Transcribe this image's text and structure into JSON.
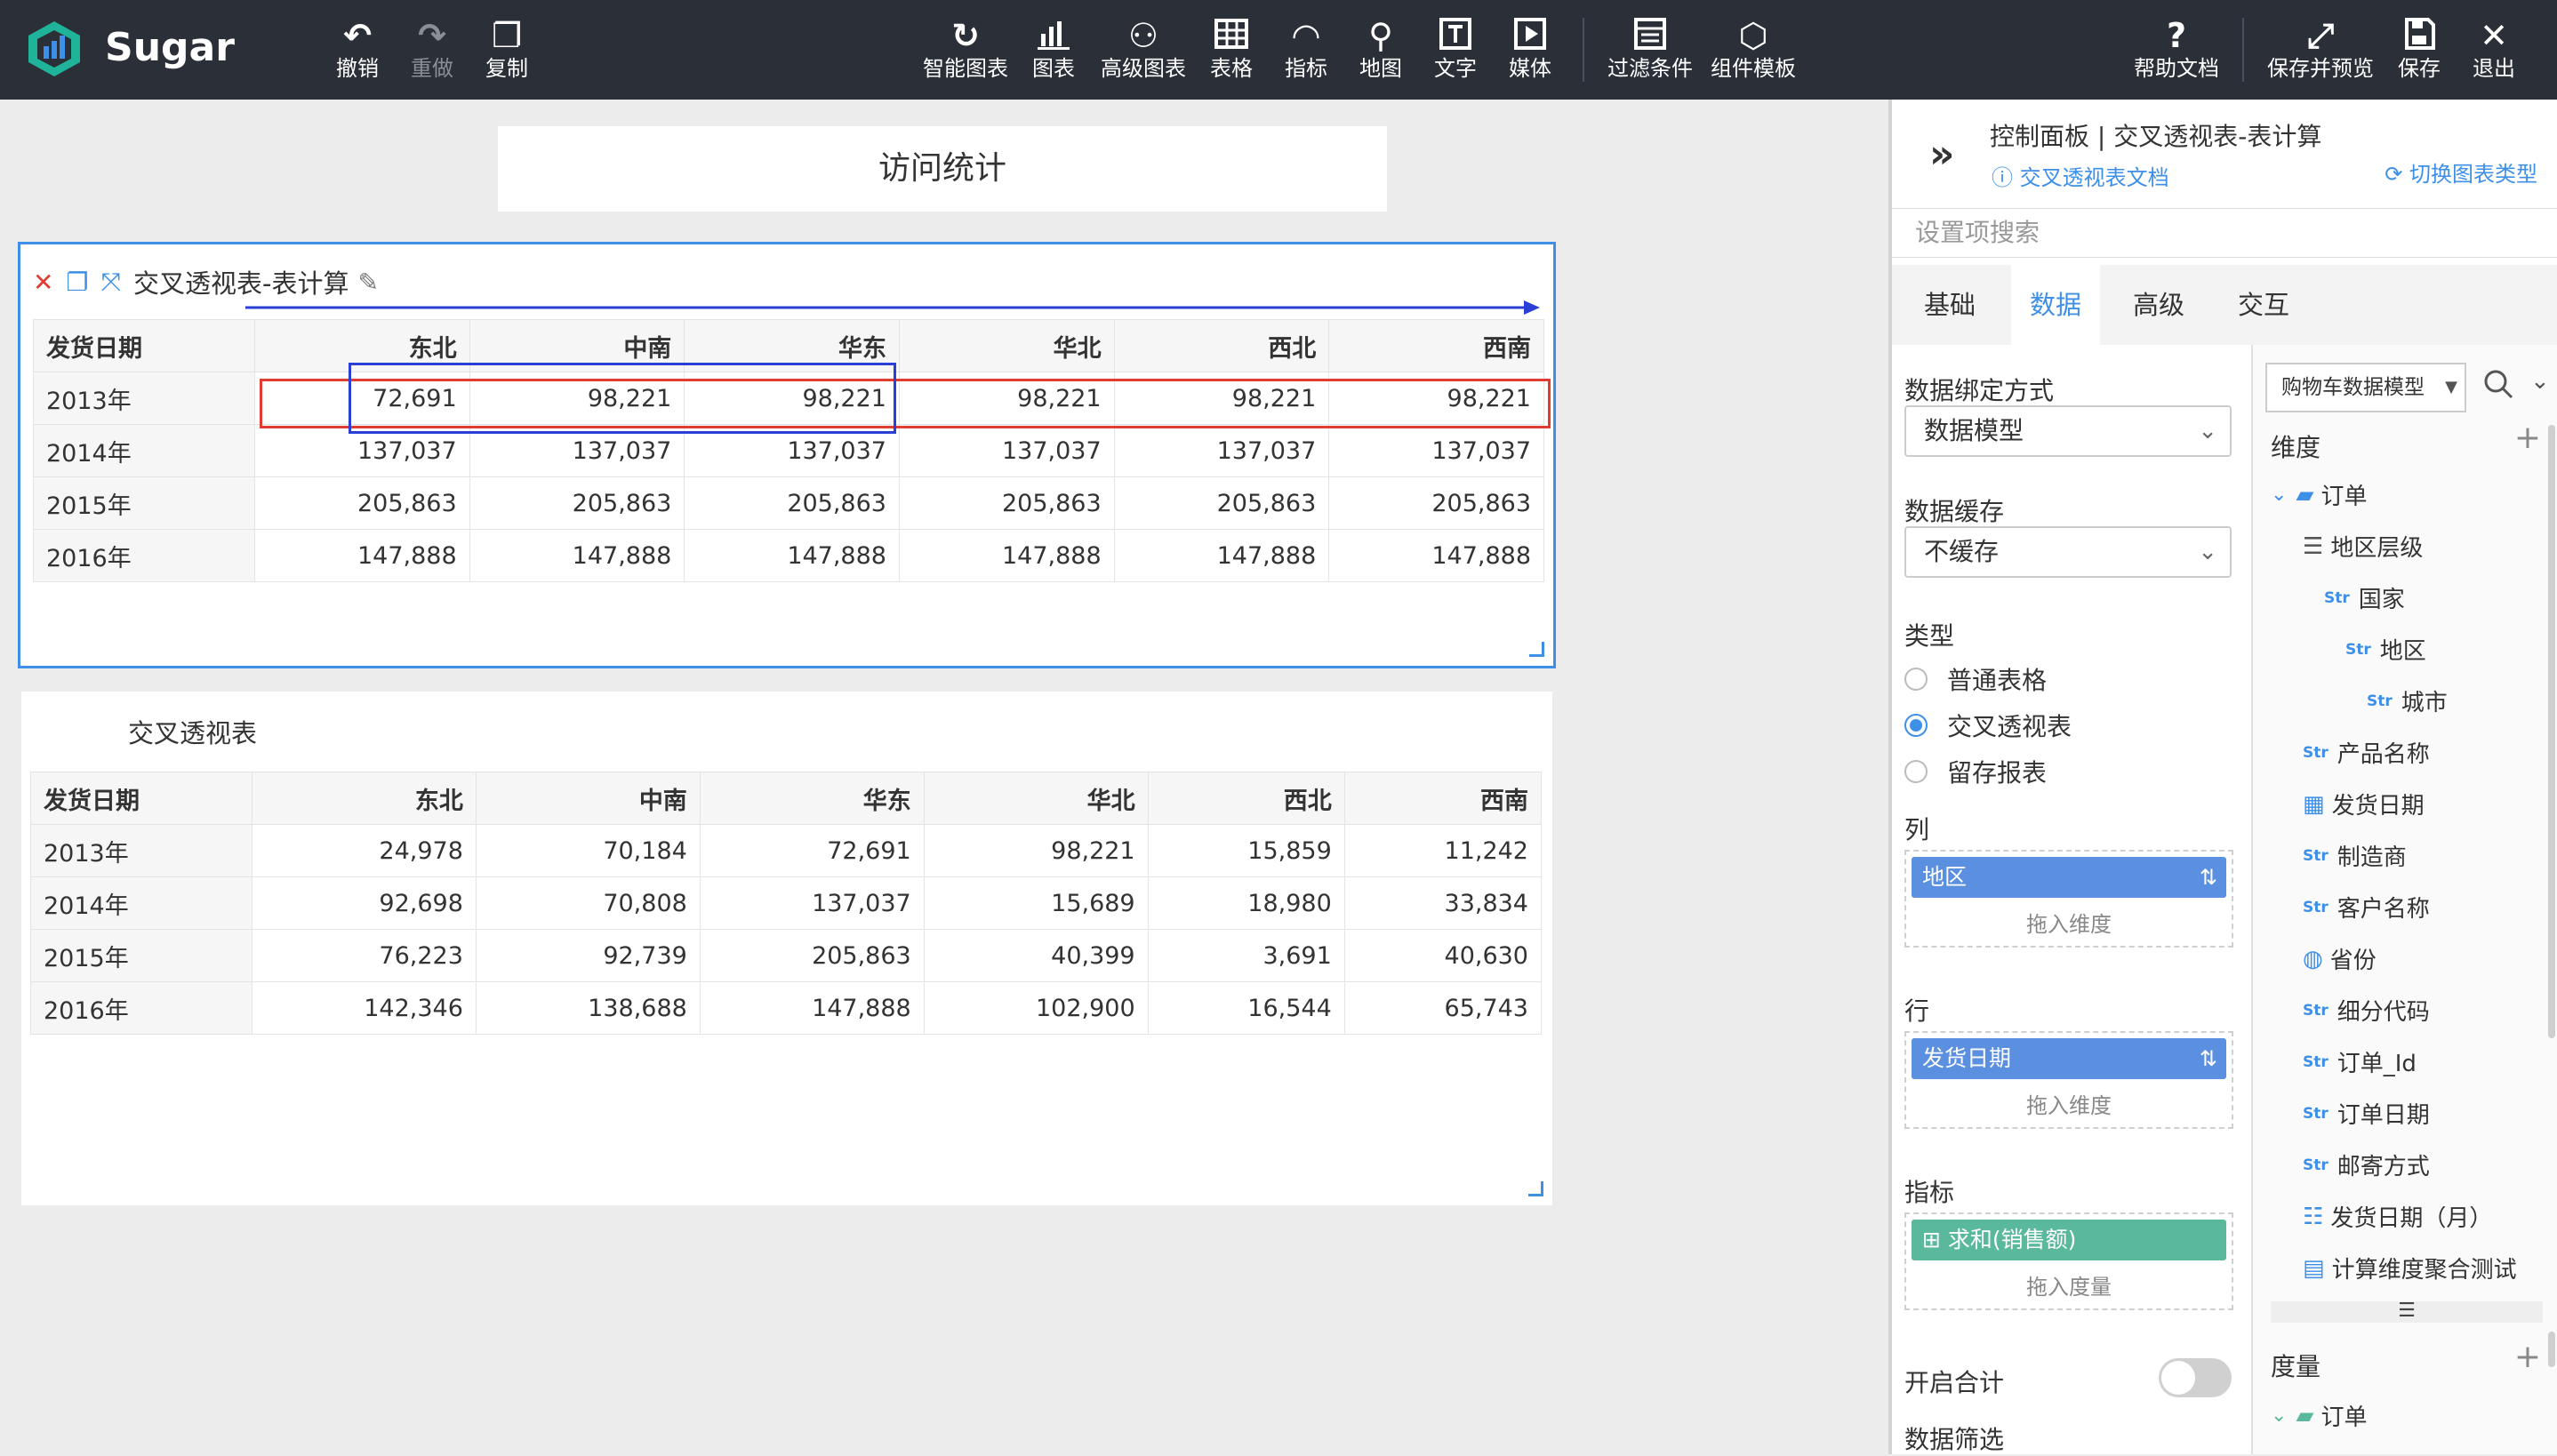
{
  "app": {
    "brand": "Sugar"
  },
  "toolbar": {
    "undo": "撤销",
    "redo": "重做",
    "copy": "复制",
    "smart_chart": "智能图表",
    "chart": "图表",
    "advanced_chart": "高级图表",
    "table": "表格",
    "indicator": "指标",
    "map": "地图",
    "text": "文字",
    "media": "媒体",
    "filter": "过滤条件",
    "template": "组件模板",
    "help": "帮助文档",
    "save_preview": "保存并预览",
    "save": "保存",
    "exit": "退出"
  },
  "canvas": {
    "page_title": "访问统计",
    "widget1": {
      "title": "交叉透视表-表计算",
      "headers": [
        "发货日期",
        "东北",
        "中南",
        "华东",
        "华北",
        "西北",
        "西南"
      ],
      "rows": [
        [
          "2013年",
          "72,691",
          "98,221",
          "98,221",
          "98,221",
          "98,221",
          "98,221"
        ],
        [
          "2014年",
          "137,037",
          "137,037",
          "137,037",
          "137,037",
          "137,037",
          "137,037"
        ],
        [
          "2015年",
          "205,863",
          "205,863",
          "205,863",
          "205,863",
          "205,863",
          "205,863"
        ],
        [
          "2016年",
          "147,888",
          "147,888",
          "147,888",
          "147,888",
          "147,888",
          "147,888"
        ]
      ]
    },
    "widget2": {
      "title": "交叉透视表",
      "headers": [
        "发货日期",
        "东北",
        "中南",
        "华东",
        "华北",
        "西北",
        "西南"
      ],
      "rows": [
        [
          "2013年",
          "24,978",
          "70,184",
          "72,691",
          "98,221",
          "15,859",
          "11,242"
        ],
        [
          "2014年",
          "92,698",
          "70,808",
          "137,037",
          "15,689",
          "18,980",
          "33,834"
        ],
        [
          "2015年",
          "76,223",
          "92,739",
          "205,863",
          "40,399",
          "3,691",
          "40,630"
        ],
        [
          "2016年",
          "142,346",
          "138,688",
          "147,888",
          "102,900",
          "16,544",
          "65,743"
        ]
      ]
    }
  },
  "panel": {
    "title": "控制面板 | 交叉透视表-表计算",
    "doc_link": "交叉透视表文档",
    "switch_link": "切换图表类型",
    "search_placeholder": "设置项搜索",
    "tabs": [
      "基础",
      "数据",
      "高级",
      "交互"
    ],
    "active_tab": "数据",
    "binding_label": "数据绑定方式",
    "binding_value": "数据模型",
    "cache_label": "数据缓存",
    "cache_value": "不缓存",
    "type_label": "类型",
    "types": [
      "普通表格",
      "交叉透视表",
      "留存报表"
    ],
    "type_selected": "交叉透视表",
    "col_label": "列",
    "col_pill": "地区",
    "row_label": "行",
    "row_pill": "发货日期",
    "dim_hint": "拖入维度",
    "measure_label": "指标",
    "measure_pill": "求和(销售额)",
    "measure_hint": "拖入度量",
    "total_label": "开启合计",
    "total_on": false,
    "filter_label": "数据筛选",
    "model_select": "购物车数据模型",
    "dimension_head": "维度",
    "measure_head": "度量",
    "dimension_tree": [
      "订单",
      "地区层级",
      "国家",
      "地区",
      "城市",
      "产品名称",
      "发货日期",
      "制造商",
      "客户名称",
      "省份",
      "细分代码",
      "订单_Id",
      "订单日期",
      "邮寄方式",
      "发货日期（月）",
      "计算维度聚合测试"
    ],
    "measure_tree_first": "订单",
    "str_tag": "Str"
  },
  "colors": {
    "accent": "#3d8fe8",
    "topbar": "#2b2f38",
    "annotation_red": "#e03c31",
    "annotation_blue": "#2a3fd6",
    "pill_blue": "#5b8fe0",
    "pill_green": "#5ab99c"
  }
}
